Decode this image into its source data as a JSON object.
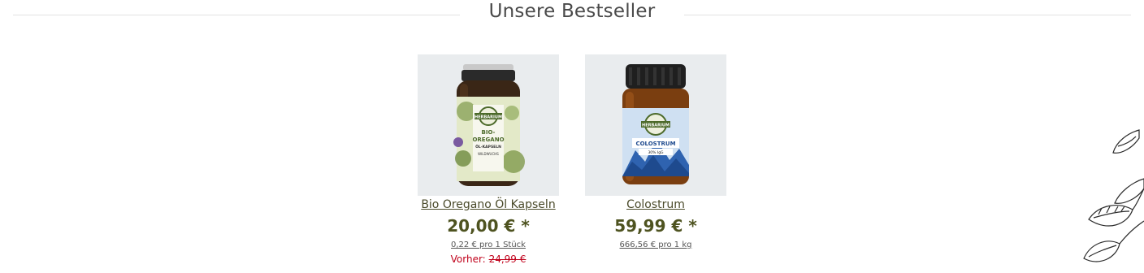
{
  "section": {
    "title": "Unsere Bestseller"
  },
  "products": [
    {
      "name": "Bio Oregano Öl Kapseln",
      "price": "20,00 € *",
      "unit_price": "0,22 € pro 1 Stück",
      "old_price_label": "Vorher:",
      "old_price": "24,99 €",
      "label_brand": "HERBARIUM",
      "label_line1": "BIO-",
      "label_line2": "OREGANO",
      "label_line3": "ÖL-KAPSELN",
      "label_line4": "WILDWUCHS"
    },
    {
      "name": "Colostrum",
      "price": "59,99 € *",
      "unit_price": "666,56 € pro 1 kg",
      "label_brand": "HERBARIUM",
      "label_line1": "COLOSTRUM",
      "label_line2": "30% IgG"
    }
  ],
  "colors": {
    "price": "#4e5320",
    "old_price": "#c0001a",
    "image_bg": "#e9ecee"
  }
}
